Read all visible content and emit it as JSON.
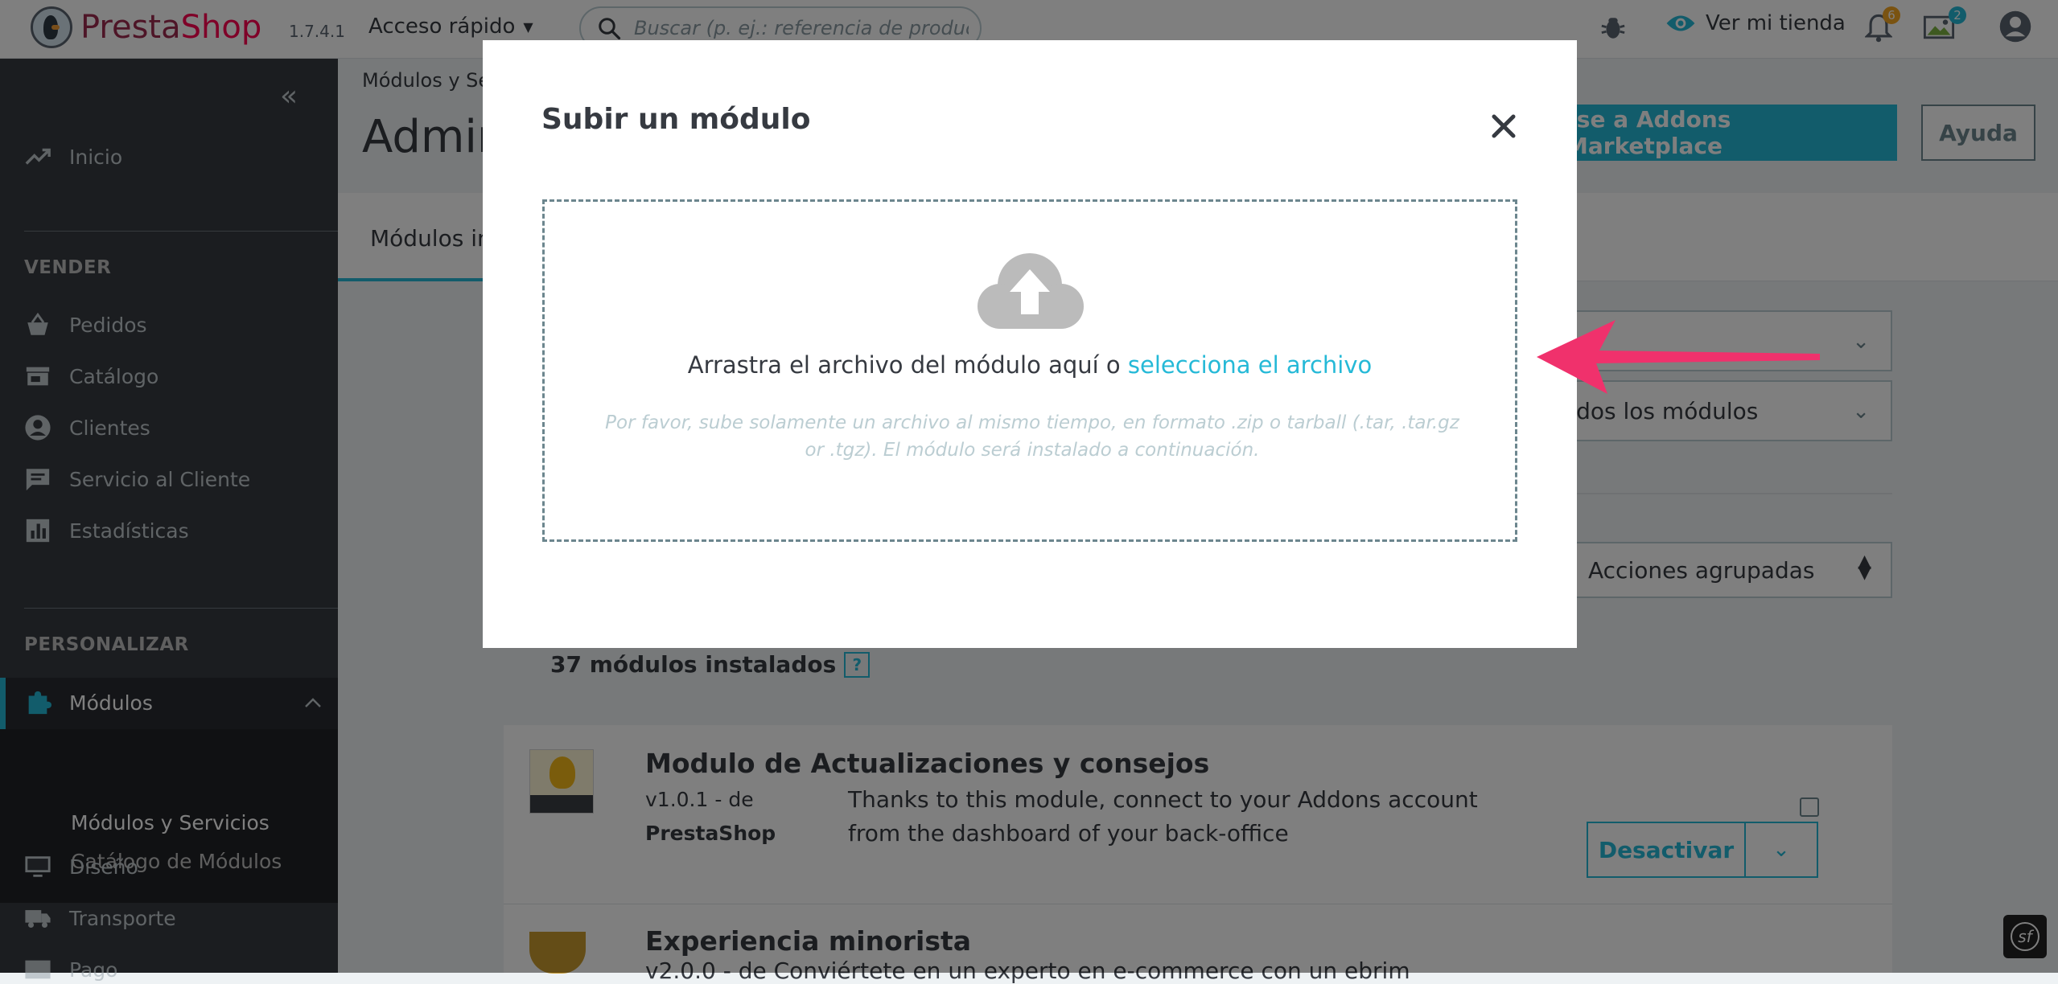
{
  "header": {
    "logo_text_presta": "Presta",
    "logo_text_shop": "Shop",
    "version": "1.7.4.1",
    "quick_access": "Acceso rápido",
    "search_placeholder": "Buscar (p. ej.: referencia de producto, no",
    "view_store": "Ver mi tienda",
    "notifications_count": "6",
    "employee_count": "2"
  },
  "sidebar": {
    "home": "Inicio",
    "section_sell": "VENDER",
    "orders": "Pedidos",
    "catalog": "Catálogo",
    "customers": "Clientes",
    "customer_service": "Servicio al Cliente",
    "stats": "Estadísticas",
    "section_customize": "PERSONALIZAR",
    "modules": "Módulos",
    "modules_services": "Módulos y Servicios",
    "modules_catalog": "Catálogo de Módulos",
    "design": "Diseño",
    "shipping": "Transporte",
    "payment_partial": "Pago"
  },
  "page": {
    "breadcrumb": "Módulos y Se",
    "title": "Admin",
    "addons_button": "rse a Addons Marketplace",
    "help_button": "Ayuda",
    "tab_installed": "Módulos in",
    "filter_all": "odos los módulos",
    "bulk_actions": "Acciones agrupadas",
    "installed_count": "37 módulos instalados",
    "help_icon_text": "?"
  },
  "modules": [
    {
      "name": "Modulo de Actualizaciones y consejos",
      "version": "v1.0.1 - de",
      "author": "PrestaShop",
      "description": "Thanks to this module, connect to your Addons account from the dashboard of your back-office",
      "action": "Desactivar"
    },
    {
      "name": "Experiencia minorista",
      "partial_text": "v2.0.0 - de       Conviértete en un experto en e-commerce con un ebrim"
    }
  ],
  "modal": {
    "title": "Subir un módulo",
    "drop_text": "Arrastra el archivo del módulo aquí o ",
    "drop_link": "selecciona el archivo",
    "hint": "Por favor, sube solamente un archivo al mismo tiempo, en formato .zip o tarball (.tar, .tar.gz or .tgz). El módulo será instalado a continuación."
  },
  "colors": {
    "accent": "#25b9d7",
    "sidebar_bg": "#363a41",
    "annotation_arrow": "#f0316c"
  },
  "icons": {
    "search": "search-icon",
    "bug": "bug-icon",
    "eye": "eye-icon",
    "bell": "bell-icon",
    "close": "close-icon",
    "upload": "cloud-upload-icon"
  }
}
